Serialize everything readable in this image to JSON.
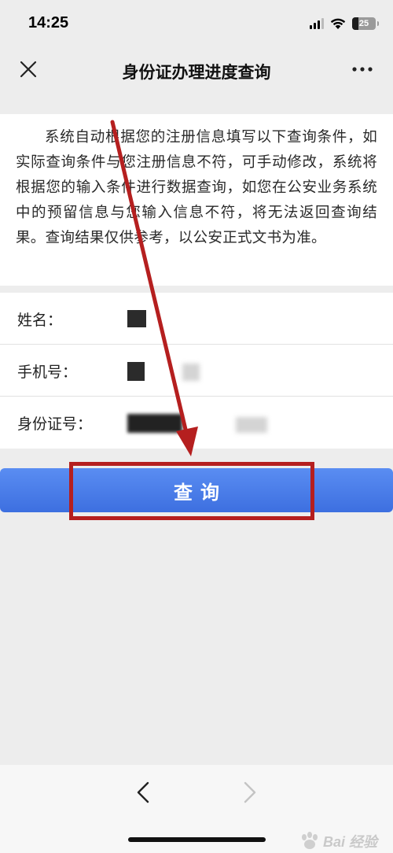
{
  "status_bar": {
    "time": "14:25",
    "battery": "25",
    "battery_level": 0.25
  },
  "nav": {
    "title": "身份证办理进度查询"
  },
  "notice": {
    "text": "系统自动根据您的注册信息填写以下查询条件，如实际查询条件与您注册信息不符，可手动修改，系统将根据您的输入条件进行数据查询，如您在公安业务系统中的预留信息与您输入信息不符，将无法返回查询结果。查询结果仅供参考，以公安正式文书为准。"
  },
  "form": {
    "name_label": "姓名：",
    "phone_label": "手机号：",
    "id_label": "身份证号："
  },
  "query_button": {
    "label": "查询"
  },
  "watermark": {
    "text": "Bai 经验"
  },
  "colors": {
    "background": "#ededed",
    "button": "#4a7ee8",
    "highlight": "#b51f1f"
  }
}
